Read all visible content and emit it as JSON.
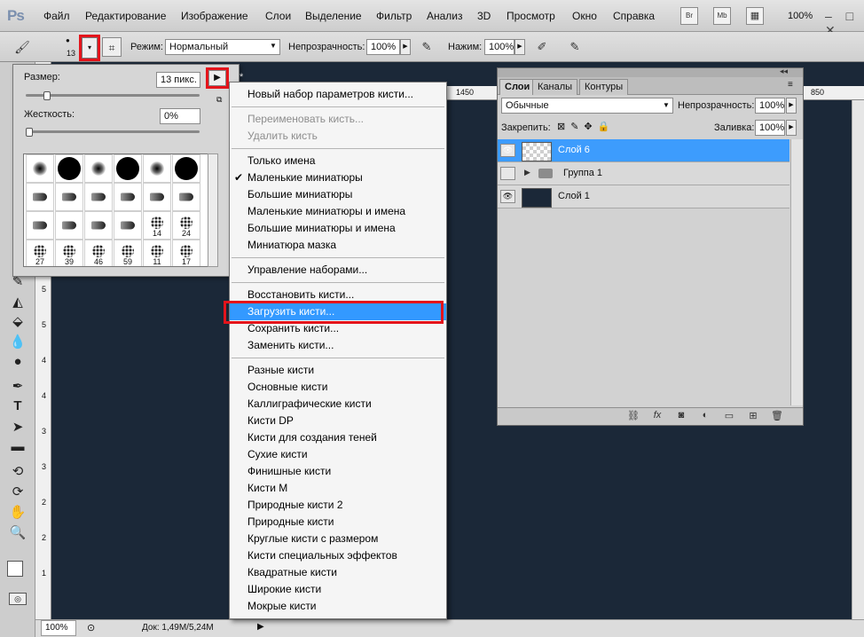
{
  "app": {
    "logo": "Ps",
    "zoom_readout": "100%",
    "window_controls": "‒ □ ✕"
  },
  "menu": [
    "Файл",
    "Редактирование",
    "Изображение",
    "Слои",
    "Выделение",
    "Фильтр",
    "Анализ",
    "3D",
    "Просмотр",
    "Окно",
    "Справка"
  ],
  "menu_mini_buttons": [
    "Br",
    "Mb"
  ],
  "options": {
    "brush_size_preview": "13",
    "mode_label": "Режим:",
    "mode_value": "Нормальный",
    "opacity_label": "Непрозрачность:",
    "opacity_value": "100%",
    "flow_label": "Нажим:",
    "flow_value": "100%"
  },
  "brush_picker": {
    "size_label": "Размер:",
    "size_value": "13 пикс.",
    "hardness_label": "Жесткость:",
    "hardness_value": "0%",
    "size_fraction": 0.05,
    "hardness_fraction": 0.0,
    "brushes": [
      {
        "kind": "soft",
        "label": ""
      },
      {
        "kind": "hard",
        "label": ""
      },
      {
        "kind": "soft",
        "label": ""
      },
      {
        "kind": "hard",
        "label": ""
      },
      {
        "kind": "soft",
        "label": ""
      },
      {
        "kind": "hard",
        "label": ""
      },
      {
        "kind": "tip",
        "label": ""
      },
      {
        "kind": "tip",
        "label": ""
      },
      {
        "kind": "tip",
        "label": ""
      },
      {
        "kind": "tip",
        "label": ""
      },
      {
        "kind": "tip",
        "label": ""
      },
      {
        "kind": "tip",
        "label": ""
      },
      {
        "kind": "tip",
        "label": ""
      },
      {
        "kind": "tip",
        "label": ""
      },
      {
        "kind": "tip",
        "label": ""
      },
      {
        "kind": "tip",
        "label": ""
      },
      {
        "kind": "splatter",
        "label": "14"
      },
      {
        "kind": "splatter",
        "label": "24"
      },
      {
        "kind": "splatter",
        "label": "27"
      },
      {
        "kind": "splatter",
        "label": "39"
      },
      {
        "kind": "splatter",
        "label": "46"
      },
      {
        "kind": "splatter",
        "label": "59"
      },
      {
        "kind": "splatter",
        "label": "11"
      },
      {
        "kind": "splatter",
        "label": "17"
      }
    ]
  },
  "context_menu": {
    "items": [
      {
        "label": "Новый набор параметров кисти...",
        "disabled": false,
        "checked": false,
        "highlight": false
      },
      {
        "sep": true
      },
      {
        "label": "Переименовать кисть...",
        "disabled": true,
        "checked": false,
        "highlight": false
      },
      {
        "label": "Удалить кисть",
        "disabled": true,
        "checked": false,
        "highlight": false
      },
      {
        "sep": true
      },
      {
        "label": "Только имена",
        "disabled": false,
        "checked": false,
        "highlight": false
      },
      {
        "label": "Маленькие миниатюры",
        "disabled": false,
        "checked": true,
        "highlight": false
      },
      {
        "label": "Большие миниатюры",
        "disabled": false,
        "checked": false,
        "highlight": false
      },
      {
        "label": "Маленькие миниатюры и имена",
        "disabled": false,
        "checked": false,
        "highlight": false
      },
      {
        "label": "Большие миниатюры и имена",
        "disabled": false,
        "checked": false,
        "highlight": false
      },
      {
        "label": "Миниатюра мазка",
        "disabled": false,
        "checked": false,
        "highlight": false
      },
      {
        "sep": true
      },
      {
        "label": "Управление наборами...",
        "disabled": false,
        "checked": false,
        "highlight": false
      },
      {
        "sep": true
      },
      {
        "label": "Восстановить кисти...",
        "disabled": false,
        "checked": false,
        "highlight": false
      },
      {
        "label": "Загрузить кисти...",
        "disabled": false,
        "checked": false,
        "highlight": true
      },
      {
        "label": "Сохранить кисти...",
        "disabled": false,
        "checked": false,
        "highlight": false
      },
      {
        "label": "Заменить кисти...",
        "disabled": false,
        "checked": false,
        "highlight": false
      },
      {
        "sep": true
      },
      {
        "label": "Разные кисти",
        "disabled": false,
        "checked": false,
        "highlight": false
      },
      {
        "label": "Основные кисти",
        "disabled": false,
        "checked": false,
        "highlight": false
      },
      {
        "label": "Каллиграфические кисти",
        "disabled": false,
        "checked": false,
        "highlight": false
      },
      {
        "label": "Кисти DP",
        "disabled": false,
        "checked": false,
        "highlight": false
      },
      {
        "label": "Кисти для создания теней",
        "disabled": false,
        "checked": false,
        "highlight": false
      },
      {
        "label": "Сухие кисти",
        "disabled": false,
        "checked": false,
        "highlight": false
      },
      {
        "label": "Финишные кисти",
        "disabled": false,
        "checked": false,
        "highlight": false
      },
      {
        "label": "Кисти M",
        "disabled": false,
        "checked": false,
        "highlight": false
      },
      {
        "label": "Природные кисти 2",
        "disabled": false,
        "checked": false,
        "highlight": false
      },
      {
        "label": "Природные кисти",
        "disabled": false,
        "checked": false,
        "highlight": false
      },
      {
        "label": "Круглые кисти с размером",
        "disabled": false,
        "checked": false,
        "highlight": false
      },
      {
        "label": "Кисти специальных эффектов",
        "disabled": false,
        "checked": false,
        "highlight": false
      },
      {
        "label": "Квадратные кисти",
        "disabled": false,
        "checked": false,
        "highlight": false
      },
      {
        "label": "Широкие кисти",
        "disabled": false,
        "checked": false,
        "highlight": false
      },
      {
        "label": "Мокрые кисти",
        "disabled": false,
        "checked": false,
        "highlight": false
      }
    ]
  },
  "layers_panel": {
    "tabs": [
      "Слои",
      "Каналы",
      "Контуры"
    ],
    "blend_mode": "Обычные",
    "opacity_label": "Непрозрачность:",
    "opacity_value": "100%",
    "lock_label": "Закрепить:",
    "fill_label": "Заливка:",
    "fill_value": "100%",
    "layers": [
      {
        "name": "Слой 6",
        "visible": true,
        "selected": true,
        "type": "transparent"
      },
      {
        "name": "Группа 1",
        "visible": false,
        "selected": false,
        "type": "group"
      },
      {
        "name": "Слой 1",
        "visible": true,
        "selected": false,
        "type": "dark"
      }
    ]
  },
  "ruler": {
    "h_labels": [
      "1450",
      "850"
    ],
    "v_labels": [
      "5",
      "5",
      "4",
      "4",
      "3",
      "3",
      "2",
      "2",
      "1"
    ]
  },
  "status": {
    "zoom": "100%",
    "doc": "Док: 1,49M/5,24M"
  },
  "colors": {
    "canvas": "#1b2838",
    "highlight": "#3399ff",
    "selected_layer": "#3d9cfd",
    "callout": "#e4141b"
  }
}
